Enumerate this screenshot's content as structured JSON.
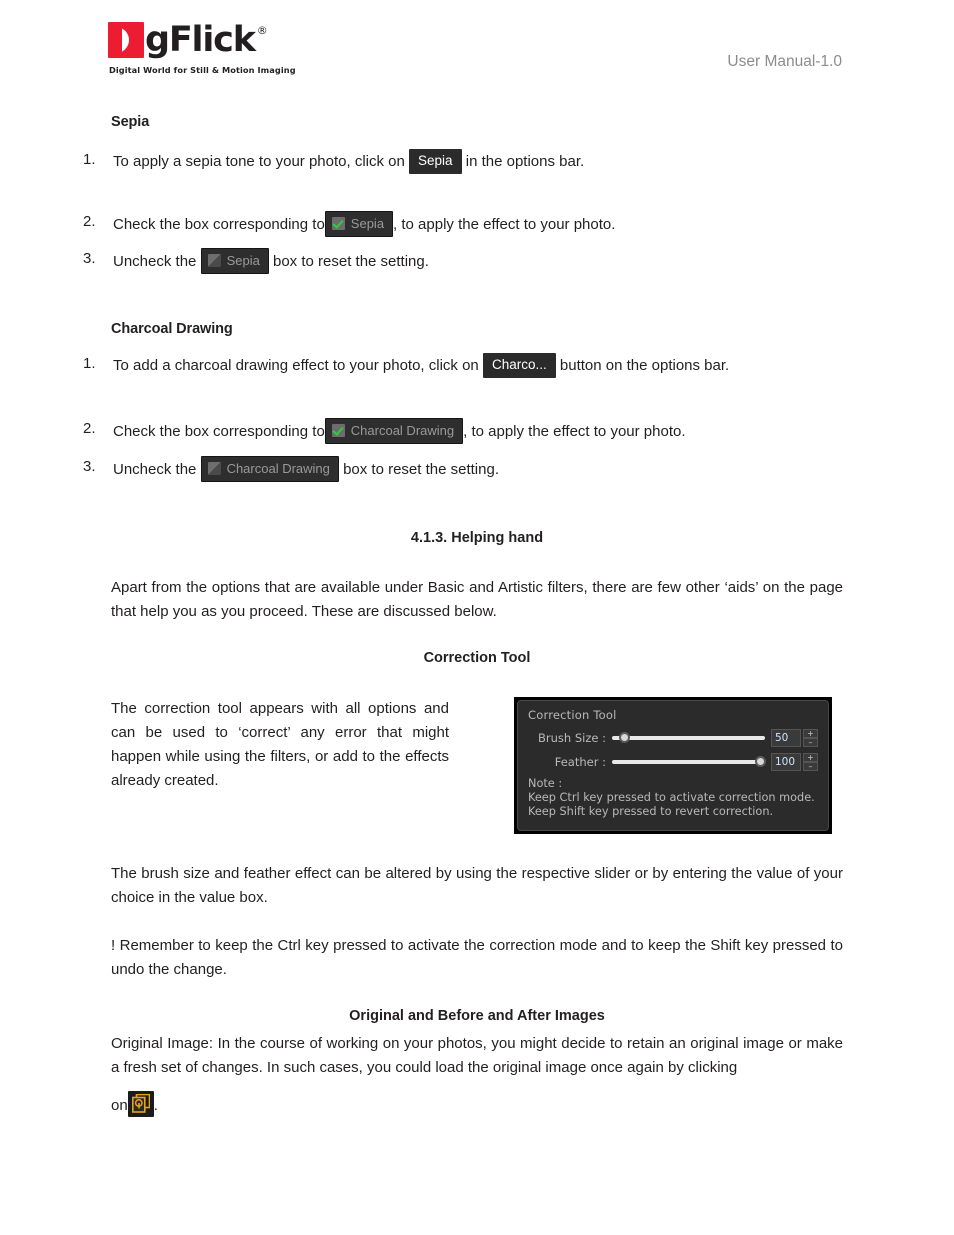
{
  "header": {
    "logo_letter": "D",
    "logo_word": "gFlick",
    "logo_reg": "®",
    "logo_tagline": "Digital World for Still & Motion Imaging",
    "manual_version": "User Manual-1.0"
  },
  "sepia_section": {
    "heading": "Sepia",
    "item1_num": "1.",
    "item1_before": "To apply a sepia tone to your photo, click on",
    "item1_chip": "Sepia",
    "item1_after": "in the options bar.",
    "item2_num": "2.",
    "item2_before": "Check the box corresponding to",
    "item2_chip": "Sepia",
    "item2_after": ", to apply the effect to your photo.",
    "item3_num": "3.",
    "item3_before": "Uncheck the",
    "item3_chip": "Sepia",
    "item3_after": "box to reset the setting."
  },
  "charcoal_section": {
    "heading": "Charcoal Drawing",
    "item1_num": "1.",
    "item1_before": "To add a charcoal drawing effect to your photo, click on",
    "item1_chip": "Charco...",
    "item1_after": "button on the options bar.",
    "item2_num": "2.",
    "item2_before": "Check the box corresponding to",
    "item2_chip": "Charcoal Drawing",
    "item2_after": ", to apply the effect to your photo.",
    "item3_num": "3.",
    "item3_before": "Uncheck the",
    "item3_chip": "Charcoal Drawing",
    "item3_after": "box to reset the setting."
  },
  "helping_hand": {
    "heading": "4.1.3. Helping hand",
    "paragraph": "Apart from the options that are available under Basic and Artistic filters, there are few other ‘aids’ on the page that help you as you proceed. These are discussed below."
  },
  "correction_tool": {
    "heading": "Correction Tool",
    "left_paragraph": "The correction tool appears with all options and can be used to ‘correct’ any error that might happen while using the filters, or add to the effects already created.",
    "paragraph_after": "The brush size and feather effect can be altered by using the respective slider or by entering the value of your choice in the value box.",
    "remember_note": "! Remember to keep the Ctrl key pressed to activate the correction mode and to keep the Shift key pressed to undo the change.",
    "panel": {
      "title": "Correction Tool",
      "brush_label": "Brush Size :",
      "brush_value": "50",
      "brush_percent": 8,
      "feather_label": "Feather :",
      "feather_value": "100",
      "feather_percent": 97,
      "spin_up": "+",
      "spin_down": "–",
      "note_title": "Note :",
      "note_line1": "Keep Ctrl key pressed to activate correction mode.",
      "note_line2": "Keep Shift key pressed to revert correction."
    }
  },
  "original_images": {
    "heading": "Original and Before and After Images",
    "paragraph_line": "Original Image: In the course of working on your photos, you might decide to retain an original image or make a fresh set of changes. In such cases, you could load the original image once again by clicking",
    "on_word": "on",
    "icon_name": "original-image-icon",
    "period": "."
  },
  "colors": {
    "brand_red": "#ec1c33",
    "ink": "#231f20",
    "muted": "#8c8c8c",
    "panel_bg": "#2b2b2b",
    "check_green": "#2ecc40",
    "icon_gold": "#e8a317"
  }
}
